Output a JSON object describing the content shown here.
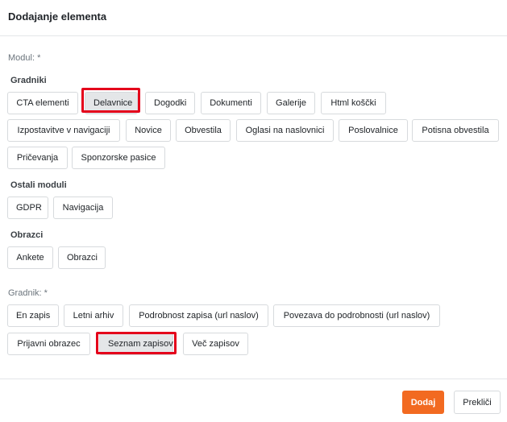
{
  "dialog": {
    "title": "Dodajanje elementa"
  },
  "modul": {
    "label": "Modul: *",
    "groups": [
      {
        "title": "Gradniki",
        "items": [
          "CTA elementi",
          "Delavnice",
          "Dogodki",
          "Dokumenti",
          "Galerije",
          "Html koščki",
          "Izpostavitve v navigaciji",
          "Novice",
          "Obvestila",
          "Oglasi na naslovnici",
          "Poslovalnice",
          "Potisna obvestila",
          "Pričevanja",
          "Sponzorske pasice"
        ]
      },
      {
        "title": "Ostali moduli",
        "items": [
          "GDPR",
          "Navigacija"
        ]
      },
      {
        "title": "Obrazci",
        "items": [
          "Ankete",
          "Obrazci"
        ]
      }
    ],
    "selected": "Delavnice"
  },
  "gradnik": {
    "label": "Gradnik: *",
    "items": [
      "En zapis",
      "Letni arhiv",
      "Podrobnost zapisa (url naslov)",
      "Povezava do podrobnosti (url naslov)",
      "Prijavni obrazec",
      "Seznam zapisov",
      "Več zapisov"
    ],
    "selected": "Seznam zapisov"
  },
  "footer": {
    "submit_label": "Dodaj",
    "cancel_label": "Prekliči"
  },
  "colors": {
    "accent": "#f26a21",
    "highlight": "#e4001b",
    "selected_bg": "#e4e6e8"
  }
}
